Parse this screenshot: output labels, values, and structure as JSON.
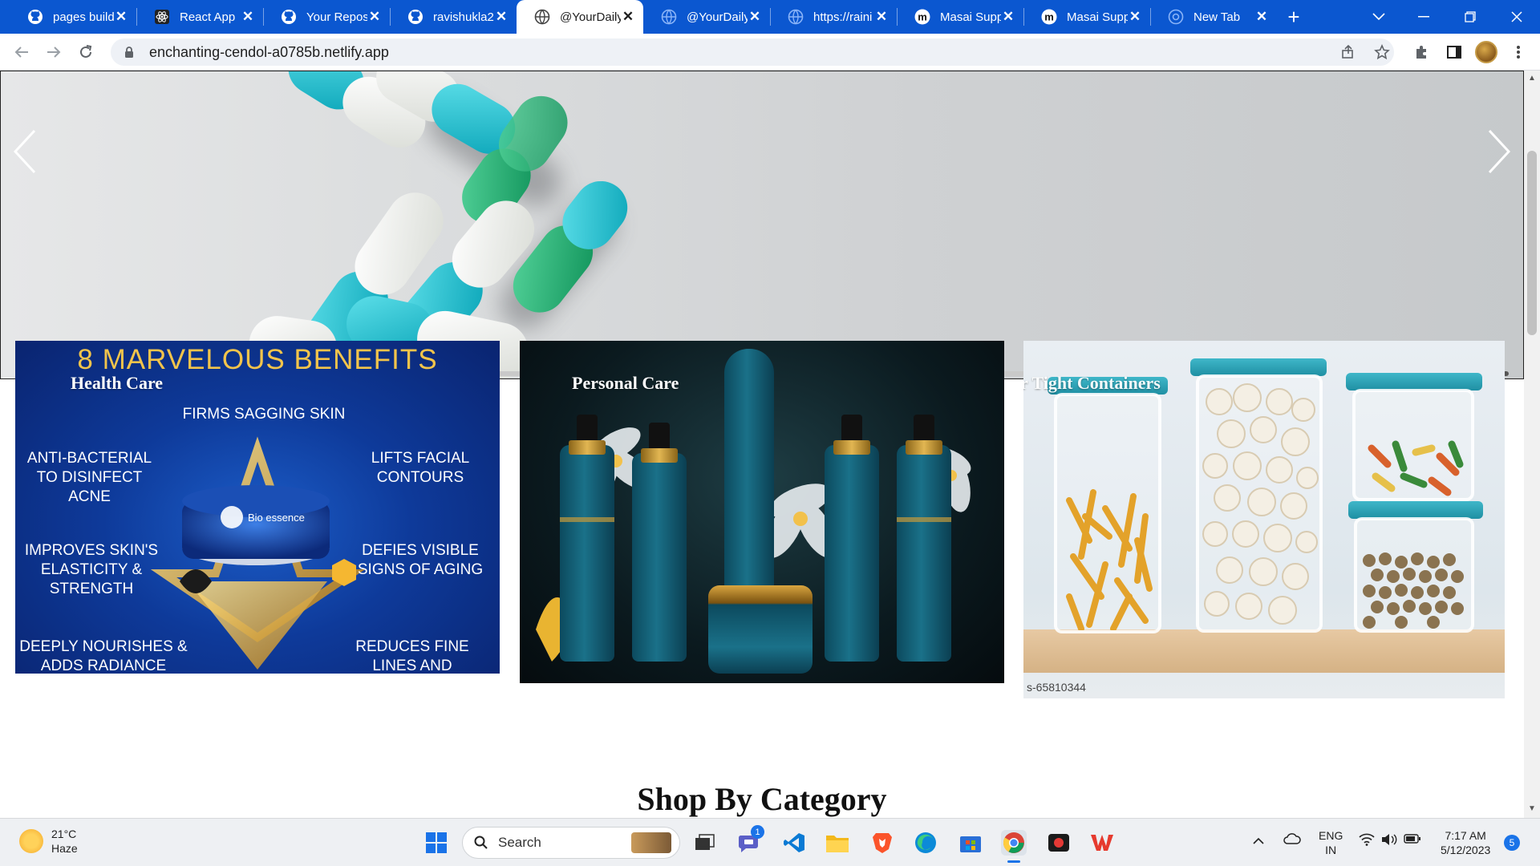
{
  "tabs": [
    {
      "title": "pages build",
      "icon": "github-icon",
      "active": false
    },
    {
      "title": "React App",
      "icon": "react-icon",
      "active": false
    },
    {
      "title": "Your Reposi",
      "icon": "github-icon",
      "active": false
    },
    {
      "title": "ravishukla2",
      "icon": "github-icon",
      "active": false
    },
    {
      "title": "@YourDaily",
      "icon": "globe-icon",
      "active": true
    },
    {
      "title": "@YourDaily",
      "icon": "globe-icon",
      "active": false
    },
    {
      "title": "https://raini",
      "icon": "globe-icon",
      "active": false
    },
    {
      "title": "Masai Supp",
      "icon": "masai-icon",
      "active": false
    },
    {
      "title": "Masai Supp",
      "icon": "masai-icon",
      "active": false
    },
    {
      "title": "New Tab",
      "icon": "chrome-icon",
      "active": false
    }
  ],
  "address_bar": {
    "url": "enchanting-cendol-a0785b.netlify.app"
  },
  "carousel": {
    "slide_count": 3,
    "active_slide": 0
  },
  "categories": [
    {
      "label": "Health Care"
    },
    {
      "label": "Personal Care"
    },
    {
      "label": "Air Tight Containers"
    }
  ],
  "health_card": {
    "heading": "8 MARVELOUS BENEFITS",
    "benefits": [
      "FIRMS SAGGING SKIN",
      "ANTI-BACTERIAL TO DISINFECT ACNE",
      "LIFTS FACIAL CONTOURS",
      "IMPROVES SKIN'S ELASTICITY & STRENGTH",
      "DEFIES VISIBLE SIGNS OF AGING",
      "DEEPLY NOURISHES & ADDS RADIANCE",
      "REDUCES FINE LINES AND WRINKLES"
    ],
    "brand": "Bio essence"
  },
  "containers_card": {
    "watermark": "s-65810344"
  },
  "section_title": "Shop By Category",
  "taskbar": {
    "weather_temp": "21°C",
    "weather_desc": "Haze",
    "search_label": "Search",
    "lang_top": "ENG",
    "lang_bottom": "IN",
    "time": "7:17 AM",
    "date": "5/12/2023",
    "notifications": "5",
    "teams_badge": "1"
  },
  "colors": {
    "tabstrip": "#0b57d0",
    "omnibox": "#eef1f6",
    "taskbar": "#eef0f3"
  }
}
